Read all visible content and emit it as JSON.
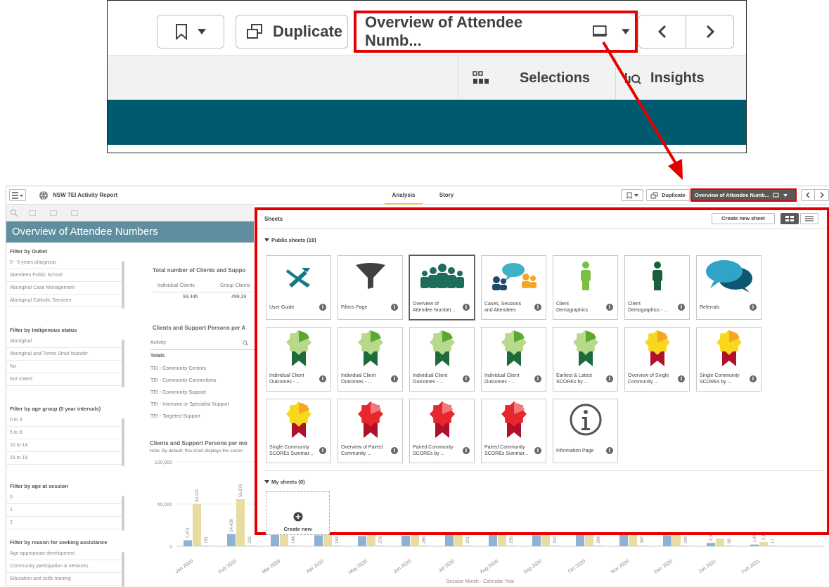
{
  "zoom": {
    "duplicate": "Duplicate",
    "sheet_title": "Overview of Attendee Numb...",
    "selections": "Selections",
    "insights": "Insights"
  },
  "app": {
    "title": "NSW TEI Activity Report",
    "tabs": [
      "Analysis",
      "Story"
    ],
    "duplicate": "Duplicate",
    "sheet_title": "Overview of Attendee Numb..."
  },
  "sheet": {
    "title": "Overview of Attendee Numbers",
    "filters": [
      {
        "title": "Filter by Outlet",
        "items": [
          "0 - 3 years playgroup",
          "Aberdeen Public School",
          "Aboriginal Case Management",
          "Aboriginal Catholic Services"
        ]
      },
      {
        "title": "Filter by Indigenous status",
        "items": [
          "Aboriginal",
          "Aboriginal and Torres Strait Islander",
          "No",
          "Not stated"
        ]
      },
      {
        "title": "Filter by age group (5 year intervals)",
        "items": [
          "0 to 4",
          "5 to 9",
          "10 to 14",
          "15 to 19"
        ]
      },
      {
        "title": "Filter by age at session",
        "items": [
          "0",
          "1",
          "2"
        ]
      },
      {
        "title": "Filter by reason for seeking assistance",
        "items": [
          "Age-appropriate development",
          "Community participation & networks",
          "Education and skills training"
        ]
      }
    ],
    "kpi_title": "Total number of Clients and Suppo",
    "kpi_cols": [
      "Individual Clients",
      "Group Clients"
    ],
    "kpi_vals": [
      "93,446",
      "499,39"
    ],
    "act_title": "Clients and Support Persons per A",
    "act_header": "Activity",
    "act_rows": [
      "Totals",
      "TEI - Community Centres",
      "TEI - Community Connections",
      "TEI - Community Support",
      "TEI - Intensive or Specialist Support",
      "TEI - Targeted Support"
    ],
    "chart_title": "Clients and Support Persons per mo",
    "chart_note": "Note: By default, this chart displays the curren",
    "x_label": "Session Month - Calendar Year"
  },
  "chart_data": {
    "type": "bar",
    "categories": [
      "Jan 2020",
      "Feb 2020",
      "Mar 2020",
      "Apr 2020",
      "May 2020",
      "Jun 2020",
      "Jul 2020",
      "Aug 2020",
      "Sep 2020",
      "Oct 2020",
      "Nov 2020",
      "Dec 2020",
      "Jan 2021",
      "Feb 2021"
    ],
    "yticks": [
      "100,000",
      "50,000",
      "0"
    ],
    "ylim": [
      0,
      100000
    ],
    "series": [
      {
        "values": [
          7074,
          14438,
          14000,
          13000,
          12000,
          12500,
          13500,
          14000,
          13000,
          14000,
          13500,
          13000,
          4000,
          2000
        ]
      },
      {
        "values": [
          50221,
          55876,
          17000,
          18000,
          16000,
          18000,
          19000,
          19500,
          19000,
          19500,
          19000,
          17500,
          9000,
          5000
        ]
      },
      {
        "values": [
          181,
          206,
          144,
          184,
          279,
          286,
          251,
          256,
          319,
          284,
          367,
          234,
          68,
          17
        ]
      }
    ],
    "labels": [
      "7,074",
      "14,438",
      "50,221",
      "55,876",
      "181",
      "206",
      "144",
      "184",
      "279",
      "286",
      "251",
      "256",
      "319",
      "284",
      "367",
      "234",
      "68",
      "17",
      "4,3",
      "2,12",
      "1,46"
    ]
  },
  "panel": {
    "header": "Sheets",
    "create_new_sheet": "Create new sheet",
    "public_header": "Public sheets (19)",
    "my_header": "My sheets (0)",
    "create_new": "Create new",
    "sheets": [
      {
        "label": "User Guide",
        "icon": "tools-icon"
      },
      {
        "label": "Filters Page",
        "icon": "funnel-icon"
      },
      {
        "label": "Overview of Attendee Number...",
        "icon": "people-group-icon"
      },
      {
        "label": "Cases, Sessions and Attendees",
        "icon": "chat-people-icon"
      },
      {
        "label": "Client Demographics",
        "icon": "person-green-icon"
      },
      {
        "label": "Client Demographics - ...",
        "icon": "person-dark-icon"
      },
      {
        "label": "Referrals",
        "icon": "speech-bubbles-icon"
      },
      {
        "label": "Individual Client Outcomes - ...",
        "icon": "ribbon-green-icon"
      },
      {
        "label": "Individual Client Outcomes - ...",
        "icon": "ribbon-green-icon"
      },
      {
        "label": "Individual Client Outcomes - ...",
        "icon": "ribbon-green-icon"
      },
      {
        "label": "Individual Client Outcomes - ...",
        "icon": "ribbon-green-icon"
      },
      {
        "label": "Earliest & Latest SCOREs by ...",
        "icon": "ribbon-green-icon"
      },
      {
        "label": "Overview of Single Community ...",
        "icon": "ribbon-yellow-icon"
      },
      {
        "label": "Single Community SCOREs by ...",
        "icon": "ribbon-yellow-icon"
      },
      {
        "label": "Single Community SCOREs Summar...",
        "icon": "ribbon-yellow-icon"
      },
      {
        "label": "Overview of Paired Community ...",
        "icon": "ribbon-red-icon"
      },
      {
        "label": "Paired Community SCOREs by ...",
        "icon": "ribbon-red-icon"
      },
      {
        "label": "Paired Community SCOREs Summar...",
        "icon": "ribbon-red-icon"
      },
      {
        "label": "Information Page",
        "icon": "info-circle-icon"
      }
    ]
  }
}
